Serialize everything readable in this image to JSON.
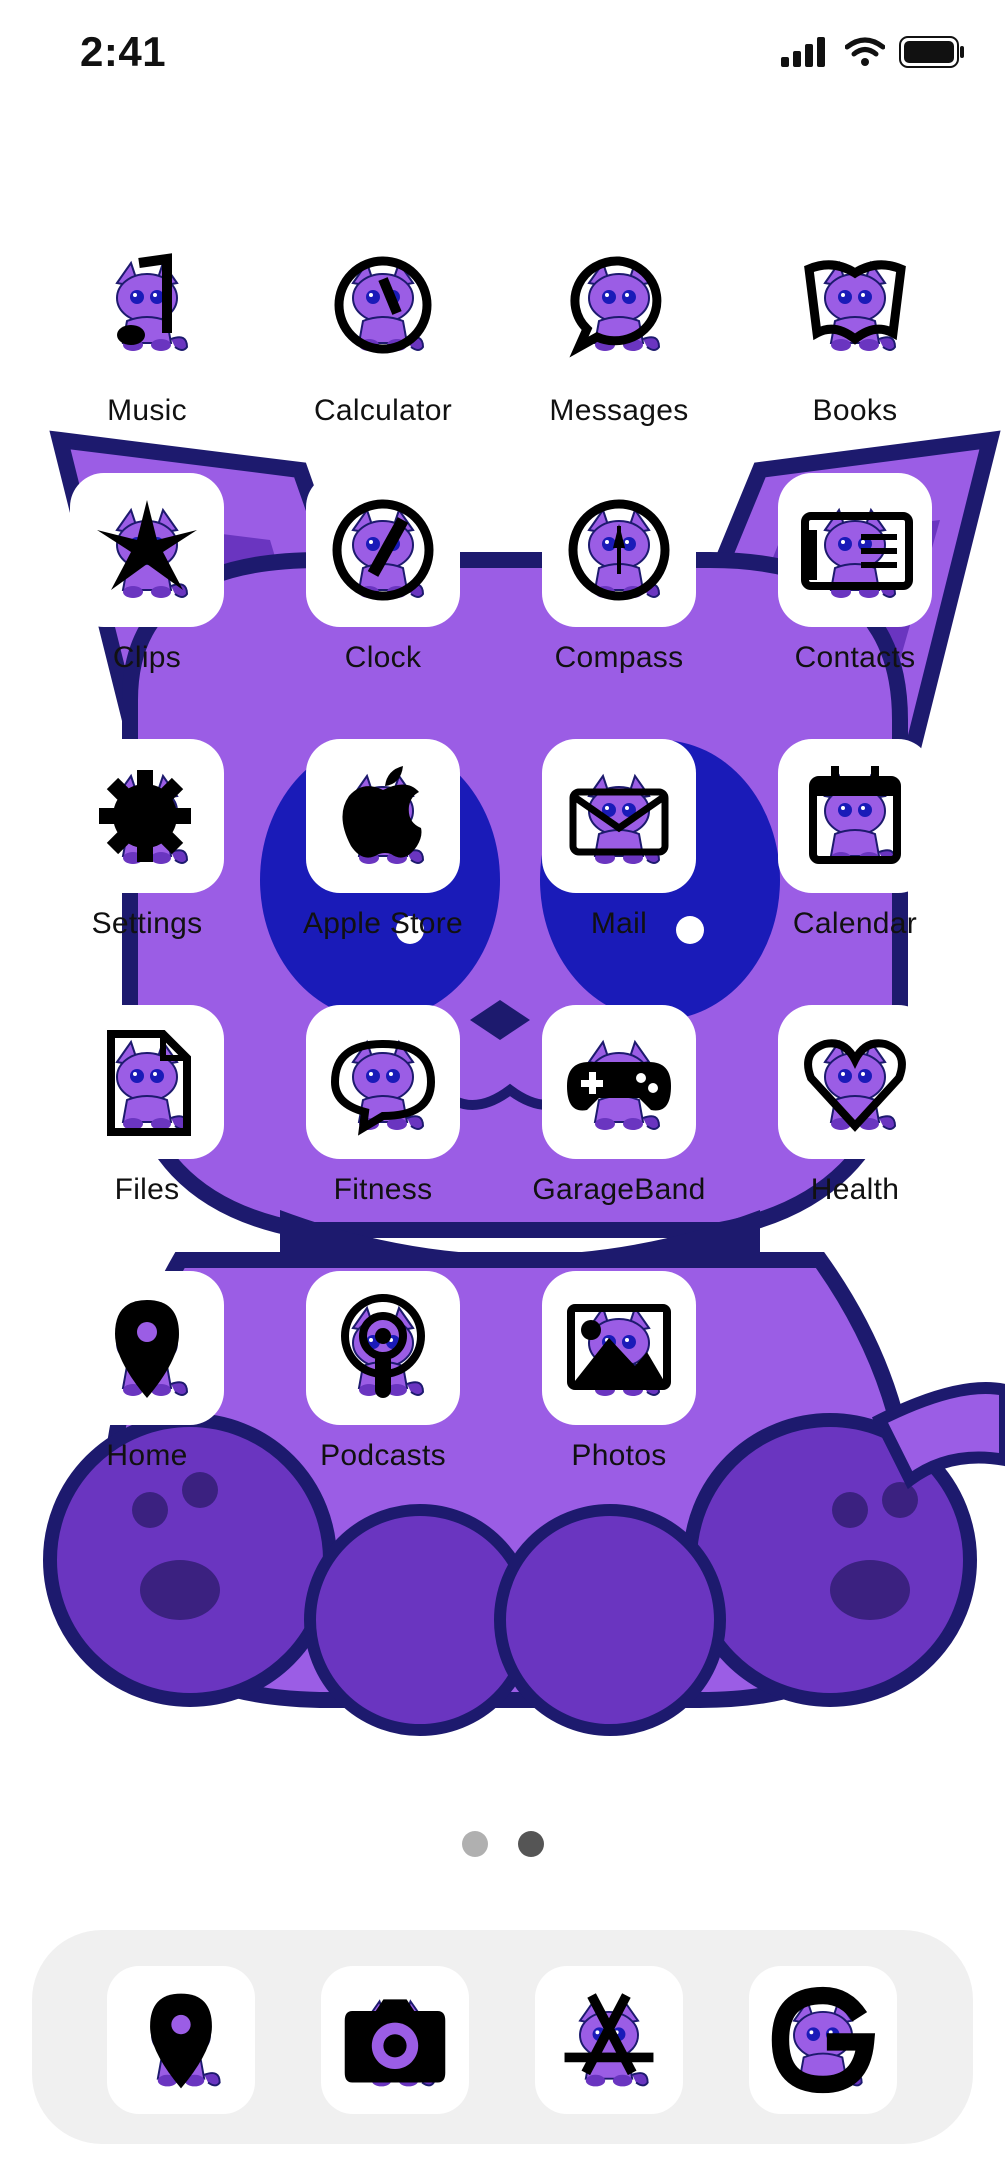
{
  "status_bar": {
    "time": "2:41"
  },
  "colors": {
    "cat_purple": "#9b5de5",
    "cat_dark": "#6a35c0",
    "cat_outline": "#1d1a6e",
    "eye_blue": "#1a1bb8",
    "tile_white": "#ffffff",
    "dot_active": "#555555",
    "dot_inactive": "#b0b0b0",
    "dock_bg": "#f0f0f0"
  },
  "apps": [
    {
      "label": "Music",
      "icon": "music-note-icon"
    },
    {
      "label": "Calculator",
      "icon": "calculator-icon"
    },
    {
      "label": "Messages",
      "icon": "message-bubble-icon"
    },
    {
      "label": "Books",
      "icon": "book-icon"
    },
    {
      "label": "Clips",
      "icon": "clips-star-icon"
    },
    {
      "label": "Clock",
      "icon": "clock-icon"
    },
    {
      "label": "Compass",
      "icon": "compass-icon"
    },
    {
      "label": "Contacts",
      "icon": "contacts-card-icon"
    },
    {
      "label": "Settings",
      "icon": "gear-icon"
    },
    {
      "label": "Apple Store",
      "icon": "apple-icon"
    },
    {
      "label": "Mail",
      "icon": "envelope-icon"
    },
    {
      "label": "Calendar",
      "icon": "calendar-icon"
    },
    {
      "label": "Files",
      "icon": "file-icon"
    },
    {
      "label": "Fitness",
      "icon": "chat-bubble-icon"
    },
    {
      "label": "GarageBand",
      "icon": "gamepad-icon"
    },
    {
      "label": "Health",
      "icon": "heart-icon"
    },
    {
      "label": "Home",
      "icon": "location-pin-icon"
    },
    {
      "label": "Podcasts",
      "icon": "podcast-icon"
    },
    {
      "label": "Photos",
      "icon": "photo-icon"
    }
  ],
  "page_indicator": {
    "count": 2,
    "current": 2
  },
  "dock": [
    {
      "icon": "location-pin-icon"
    },
    {
      "icon": "camera-icon"
    },
    {
      "icon": "app-store-icon"
    },
    {
      "icon": "google-icon"
    }
  ]
}
